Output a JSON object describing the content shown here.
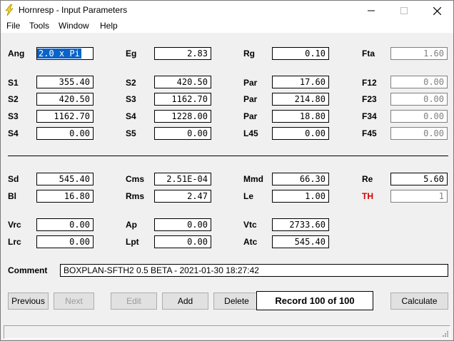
{
  "window": {
    "title": "Hornresp - Input Parameters",
    "icon": "lightning-bolt-icon"
  },
  "menu": [
    "File",
    "Tools",
    "Window",
    "Help"
  ],
  "params": {
    "Ang": "2.0 x Pi",
    "Eg": "2.83",
    "Rg": "0.10",
    "Fta": "1.60",
    "S1": "355.40",
    "S2a": "420.50",
    "Par1": "17.60",
    "F12": "0.00",
    "S2b": "420.50",
    "S3a": "1162.70",
    "Par2": "214.80",
    "F23": "0.00",
    "S3b": "1162.70",
    "S4a": "1228.00",
    "Par3": "18.80",
    "F34": "0.00",
    "S4b": "0.00",
    "S5": "0.00",
    "L45": "0.00",
    "F45": "0.00",
    "Sd": "545.40",
    "Cms": "2.51E-04",
    "Mmd": "66.30",
    "Re": "5.60",
    "Bl": "16.80",
    "Rms": "2.47",
    "Le": "1.00",
    "TH": "1",
    "Vrc": "0.00",
    "Ap": "0.00",
    "Vtc": "2733.60",
    "Lrc": "0.00",
    "Lpt": "0.00",
    "Atc": "545.40"
  },
  "labels": {
    "Ang": "Ang",
    "Eg": "Eg",
    "Rg": "Rg",
    "Fta": "Fta",
    "S1": "S1",
    "S2a": "S2",
    "Par1": "Par",
    "F12": "F12",
    "S2b": "S2",
    "S3a": "S3",
    "Par2": "Par",
    "F23": "F23",
    "S3b": "S3",
    "S4a": "S4",
    "Par3": "Par",
    "F34": "F34",
    "S4b": "S4",
    "S5": "S5",
    "L45": "L45",
    "F45": "F45",
    "Sd": "Sd",
    "Cms": "Cms",
    "Mmd": "Mmd",
    "Re": "Re",
    "Bl": "Bl",
    "Rms": "Rms",
    "Le": "Le",
    "TH": "TH",
    "Vrc": "Vrc",
    "Ap": "Ap",
    "Vtc": "Vtc",
    "Lrc": "Lrc",
    "Lpt": "Lpt",
    "Atc": "Atc",
    "Comment": "Comment"
  },
  "comment": "BOXPLAN-SFTH2 0.5 BETA - 2021-01-30 18:27:42",
  "buttons": {
    "previous": "Previous",
    "next": "Next",
    "edit": "Edit",
    "add": "Add",
    "delete": "Delete",
    "calculate": "Calculate"
  },
  "record": "Record 100 of 100",
  "colors": {
    "selection": "#0a63c9",
    "th_label": "#d40000"
  }
}
